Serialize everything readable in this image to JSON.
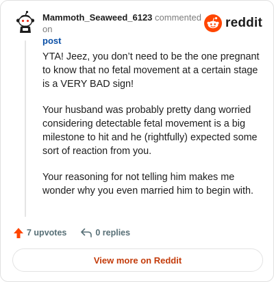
{
  "header": {
    "username": "Mammoth_Seaweed_6123",
    "action_text": "commented on",
    "post_link": "post",
    "brand_name": "reddit",
    "brand_color": "#ff4500"
  },
  "comment": {
    "paragraphs": [
      "YTA! Jeez, you don’t need to be the one pregnant to know that no fetal movement at a certain stage is a VERY BAD sign!",
      "Your husband was probably pretty dang worried considering detectable fetal movement is a big milestone to hit and he (rightfully) expected some sort of reaction from you.",
      "Your reasoning for not telling him makes me wonder why you even married him to begin with."
    ]
  },
  "actions": {
    "upvotes": "7 upvotes",
    "replies": "0 replies",
    "upvote_color": "#ff4500"
  },
  "footer": {
    "view_more": "View more on Reddit"
  }
}
